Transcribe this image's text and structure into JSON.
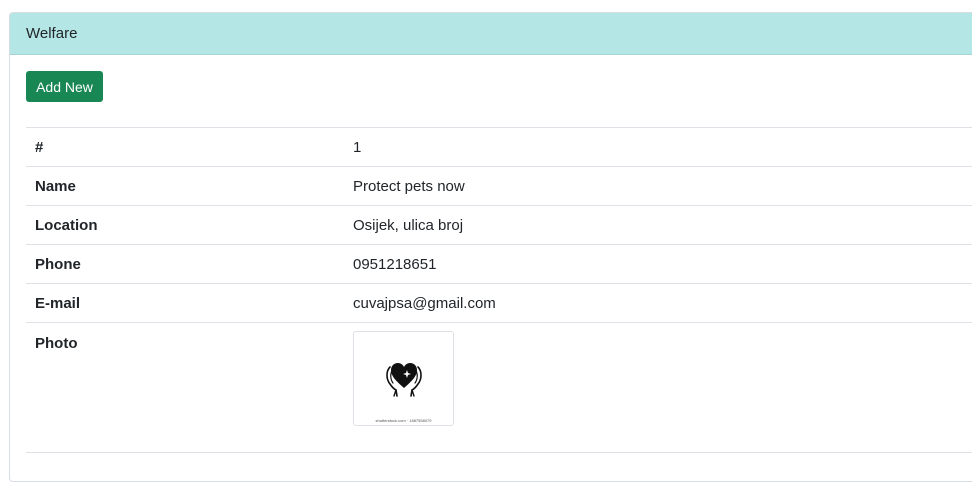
{
  "card": {
    "title": "Welfare"
  },
  "toolbar": {
    "add_new_label": "Add New"
  },
  "details": {
    "rows": [
      {
        "label": "#",
        "value": "1"
      },
      {
        "label": "Name",
        "value": "Protect pets now"
      },
      {
        "label": "Location",
        "value": "Osijek, ulica broj"
      },
      {
        "label": "Phone",
        "value": "0951218651"
      },
      {
        "label": "E-mail",
        "value": "cuvajpsa@gmail.com"
      }
    ],
    "photo": {
      "label": "Photo",
      "caption": "shutterstock.com · 1887558079",
      "icon": "hands-holding-heart-icon"
    }
  },
  "colors": {
    "header_bg": "#b4e6e6",
    "button_bg": "#198754",
    "button_text": "#ffffff",
    "border": "#dee2e6"
  }
}
